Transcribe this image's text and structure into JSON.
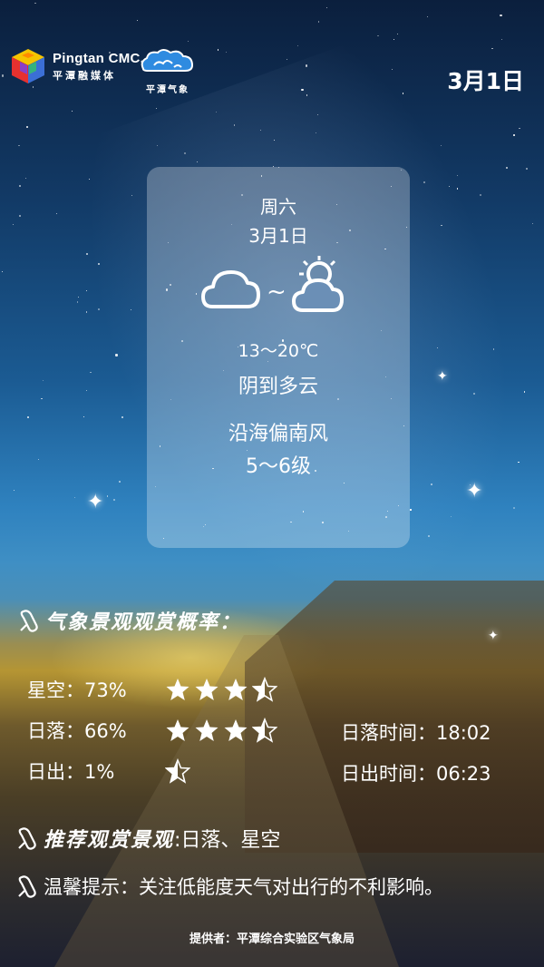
{
  "header": {
    "logo_en": "Pingtan CMC.",
    "logo_cn": "平潭融媒体",
    "meteo_logo_cn": "平潭气象",
    "date": "3月1日"
  },
  "card": {
    "weekday": "周六",
    "date": "3月1日",
    "icons": [
      "cloud-icon",
      "partly-cloudy-icon"
    ],
    "tilde": "~",
    "temperature": "13～20℃",
    "condition": "阴到多云",
    "wind_dir": "沿海偏南风",
    "wind_level": "5～6级"
  },
  "landscape": {
    "heading": "气象景观观赏概率：",
    "items": [
      {
        "label": "星空：73%",
        "stars": 3.5
      },
      {
        "label": "日落：66%",
        "stars": 3.5
      },
      {
        "label": "日出：1%",
        "stars": 0.5
      }
    ],
    "sunset_time": "日落时间：18:02",
    "sunrise_time": "日出时间：06:23"
  },
  "recommend": {
    "heading": "推荐观赏景观",
    "value": ":日落、星空"
  },
  "tip": {
    "text": "温馨提示：关注低能度天气对出行的不利影响。"
  },
  "footer": {
    "provider": "提供者：平潭综合实验区气象局"
  },
  "colors": {
    "text": "#ffffff",
    "card_bg": "rgba(255,255,255,0.28)"
  }
}
